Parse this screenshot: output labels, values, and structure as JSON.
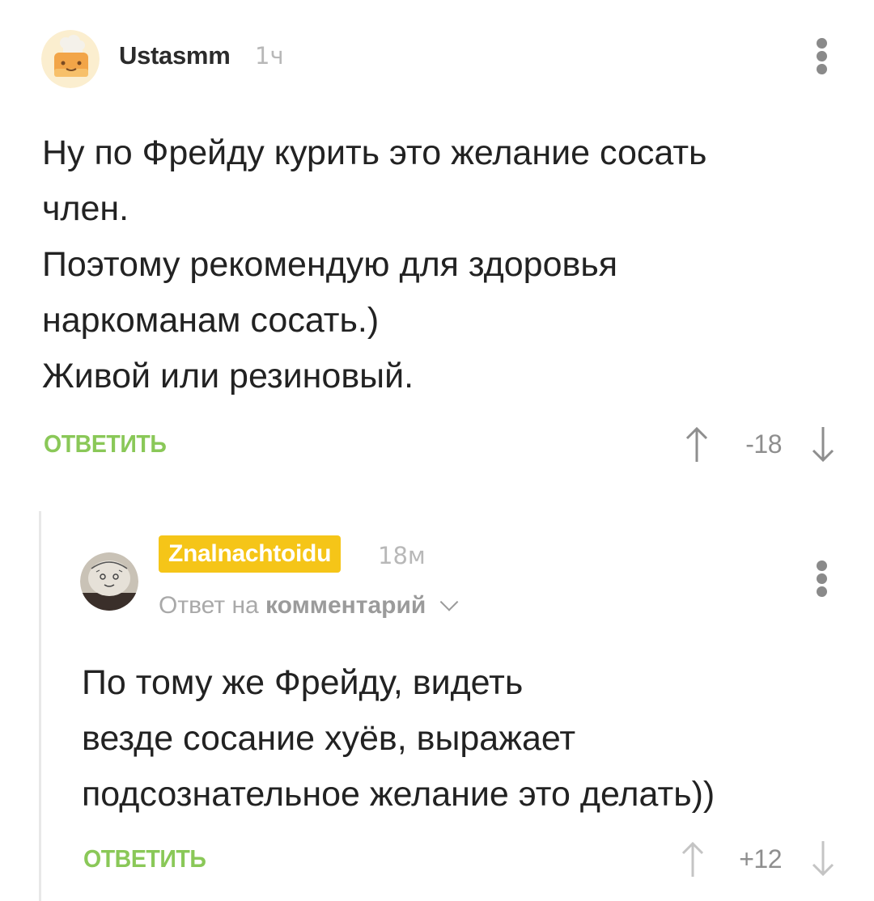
{
  "comments": [
    {
      "author": "Ustasmm",
      "time": "1ч",
      "avatar_icon": "chef-hat-avatar-icon",
      "lines": [
        "Ну по Фрейду курить это желание сосать",
        "член.",
        "Поэтому рекомендую для здоровья",
        "наркоманам сосать.)",
        "Живой или резиновый."
      ],
      "reply_label": "ОТВЕТИТЬ",
      "score": "-18",
      "menu_icon": "more-vertical-icon"
    },
    {
      "author": "Znalnachtoidu",
      "author_badge_color": "#f5c518",
      "time": "18м",
      "avatar_icon": "doodle-face-avatar-icon",
      "reply_to_prefix": "Ответ на",
      "reply_to_link": "комментарий",
      "lines": [
        "По тому же Фрейду, видеть",
        "везде сосание хуёв, выражает",
        "подсознательное желание это делать))"
      ],
      "reply_label": "ОТВЕТИТЬ",
      "score": "+12",
      "menu_icon": "more-vertical-icon"
    }
  ],
  "colors": {
    "reply_green": "#8ac858",
    "badge_yellow": "#f5c518",
    "muted_gray": "#a9a9a9",
    "text": "#222222"
  }
}
